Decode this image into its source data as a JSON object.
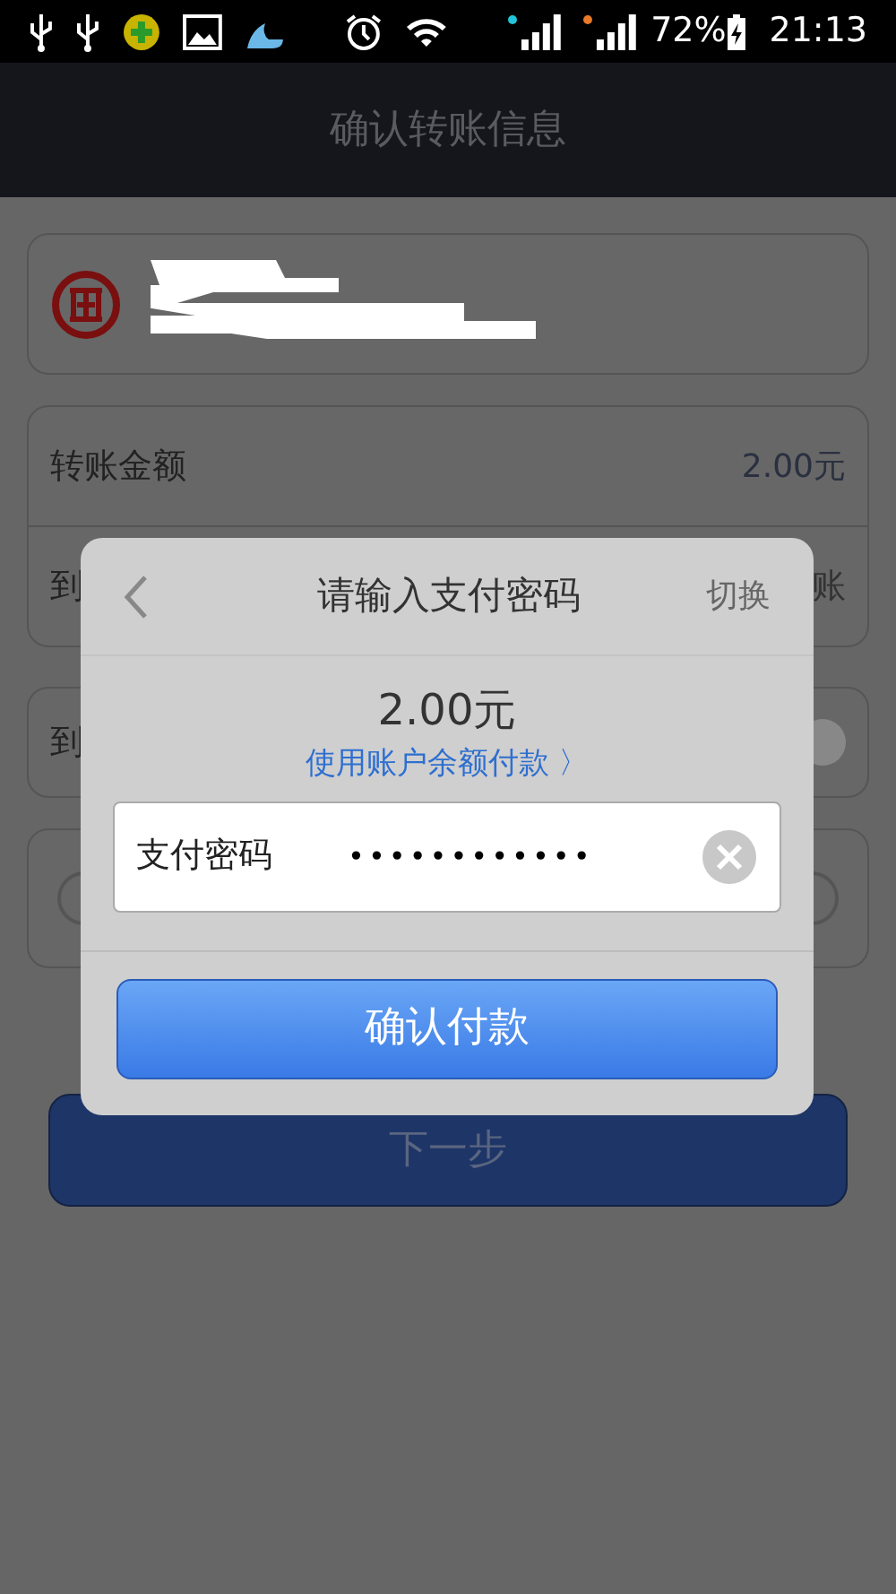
{
  "status_bar": {
    "battery": "72%",
    "time": "21:13"
  },
  "header": {
    "title": "确认转账信息"
  },
  "background_form": {
    "amount_label": "转账金额",
    "amount_value": "2.00元",
    "row_2_left": "到",
    "row_2_right": "账",
    "row_3_left": "到",
    "next_button": "下一步"
  },
  "dialog": {
    "title": "请输入支付密码",
    "switch_link": "切换",
    "amount": "2.00元",
    "balance_link": "使用账户余额付款 〉",
    "password_label": "支付密码",
    "password_value": "••••••••••••",
    "confirm_button": "确认付款"
  }
}
